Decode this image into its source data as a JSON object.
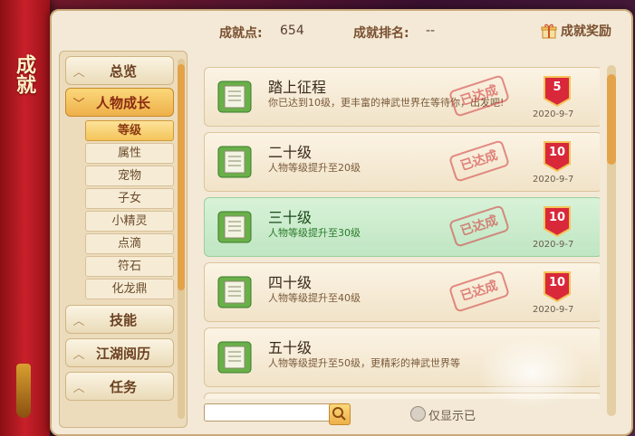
{
  "sidebar_title": "成就",
  "header": {
    "points_label": "成就点:",
    "points_value": "654",
    "rank_label": "成就排名:",
    "rank_value": "--",
    "reward_label": "成就奖励",
    "reward_icon": "gift-icon"
  },
  "nav": {
    "categories": [
      {
        "label": "总览",
        "expanded": false
      },
      {
        "label": "人物成长",
        "expanded": true
      },
      {
        "label": "技能",
        "expanded": false
      },
      {
        "label": "江湖阅历",
        "expanded": false
      },
      {
        "label": "任务",
        "expanded": false
      }
    ],
    "subitems": [
      "等级",
      "属性",
      "宠物",
      "子女",
      "小精灵",
      "点滴",
      "符石",
      "化龙鼎"
    ],
    "active_subitem": "等级"
  },
  "achievements": [
    {
      "title": "踏上征程",
      "desc": "你已达到10级，更丰富的神武世界在等待你，出发吧!",
      "stamp": "已达成",
      "points": "5",
      "date": "2020-9-7"
    },
    {
      "title": "二十级",
      "desc": "人物等级提升至20级",
      "stamp": "已达成",
      "points": "10",
      "date": "2020-9-7"
    },
    {
      "title": "三十级",
      "desc": "人物等级提升至30级",
      "stamp": "已达成",
      "points": "10",
      "date": "2020-9-7"
    },
    {
      "title": "四十级",
      "desc": "人物等级提升至40级",
      "stamp": "已达成",
      "points": "10",
      "date": "2020-9-7"
    },
    {
      "title": "五十级",
      "desc": "人物等级提升至50级，更精彩的神武世界等",
      "stamp": "",
      "points": "",
      "date": ""
    }
  ],
  "footer": {
    "search_value": "",
    "filter_label": "仅显示已"
  },
  "colors": {
    "accent": "#eeb04a",
    "highlight_row": "#bfe6c2",
    "stamp": "#d24646",
    "badge": "#d8283a"
  }
}
